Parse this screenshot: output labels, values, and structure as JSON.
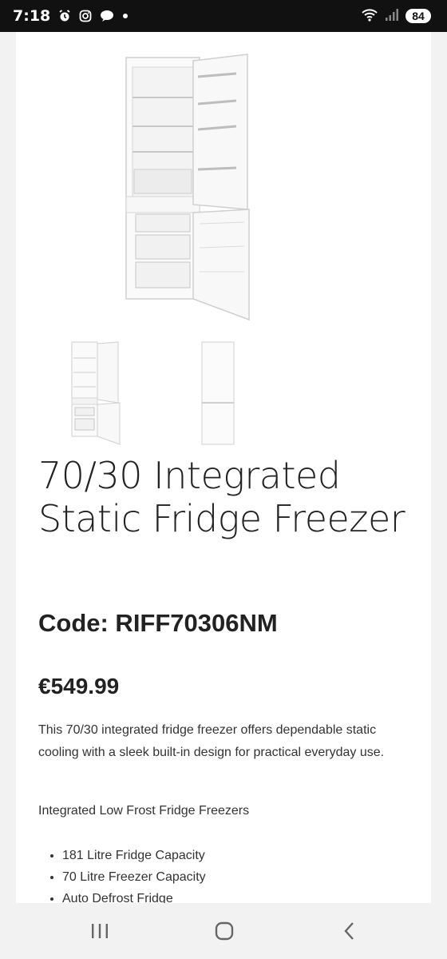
{
  "status_bar": {
    "time": "7:18",
    "battery": "84",
    "left_icons": [
      "alarm-icon",
      "instagram-icon",
      "chat-icon",
      "dot-icon"
    ],
    "right_icons": [
      "wifi-icon",
      "signal-icon",
      "battery-icon"
    ]
  },
  "product": {
    "title": "70/30 Integrated Static Fridge Freezer",
    "code": "Code: RIFF70306NM",
    "price": "€549.99",
    "description": "This 70/30 integrated fridge freezer offers dependable static cooling with a sleek built-in design for practical everyday use.",
    "category": "Integrated Low Frost Fridge Freezers",
    "features": [
      "181 Litre Fridge Capacity",
      "70 Litre Freezer Capacity",
      "Auto Defrost Fridge"
    ]
  },
  "nav_bar": {
    "icons": [
      "recent-apps-icon",
      "home-icon",
      "back-icon"
    ]
  },
  "colors": {
    "status_bar_bg": "#111111",
    "page_bg": "#ffffff",
    "text": "#222222"
  }
}
